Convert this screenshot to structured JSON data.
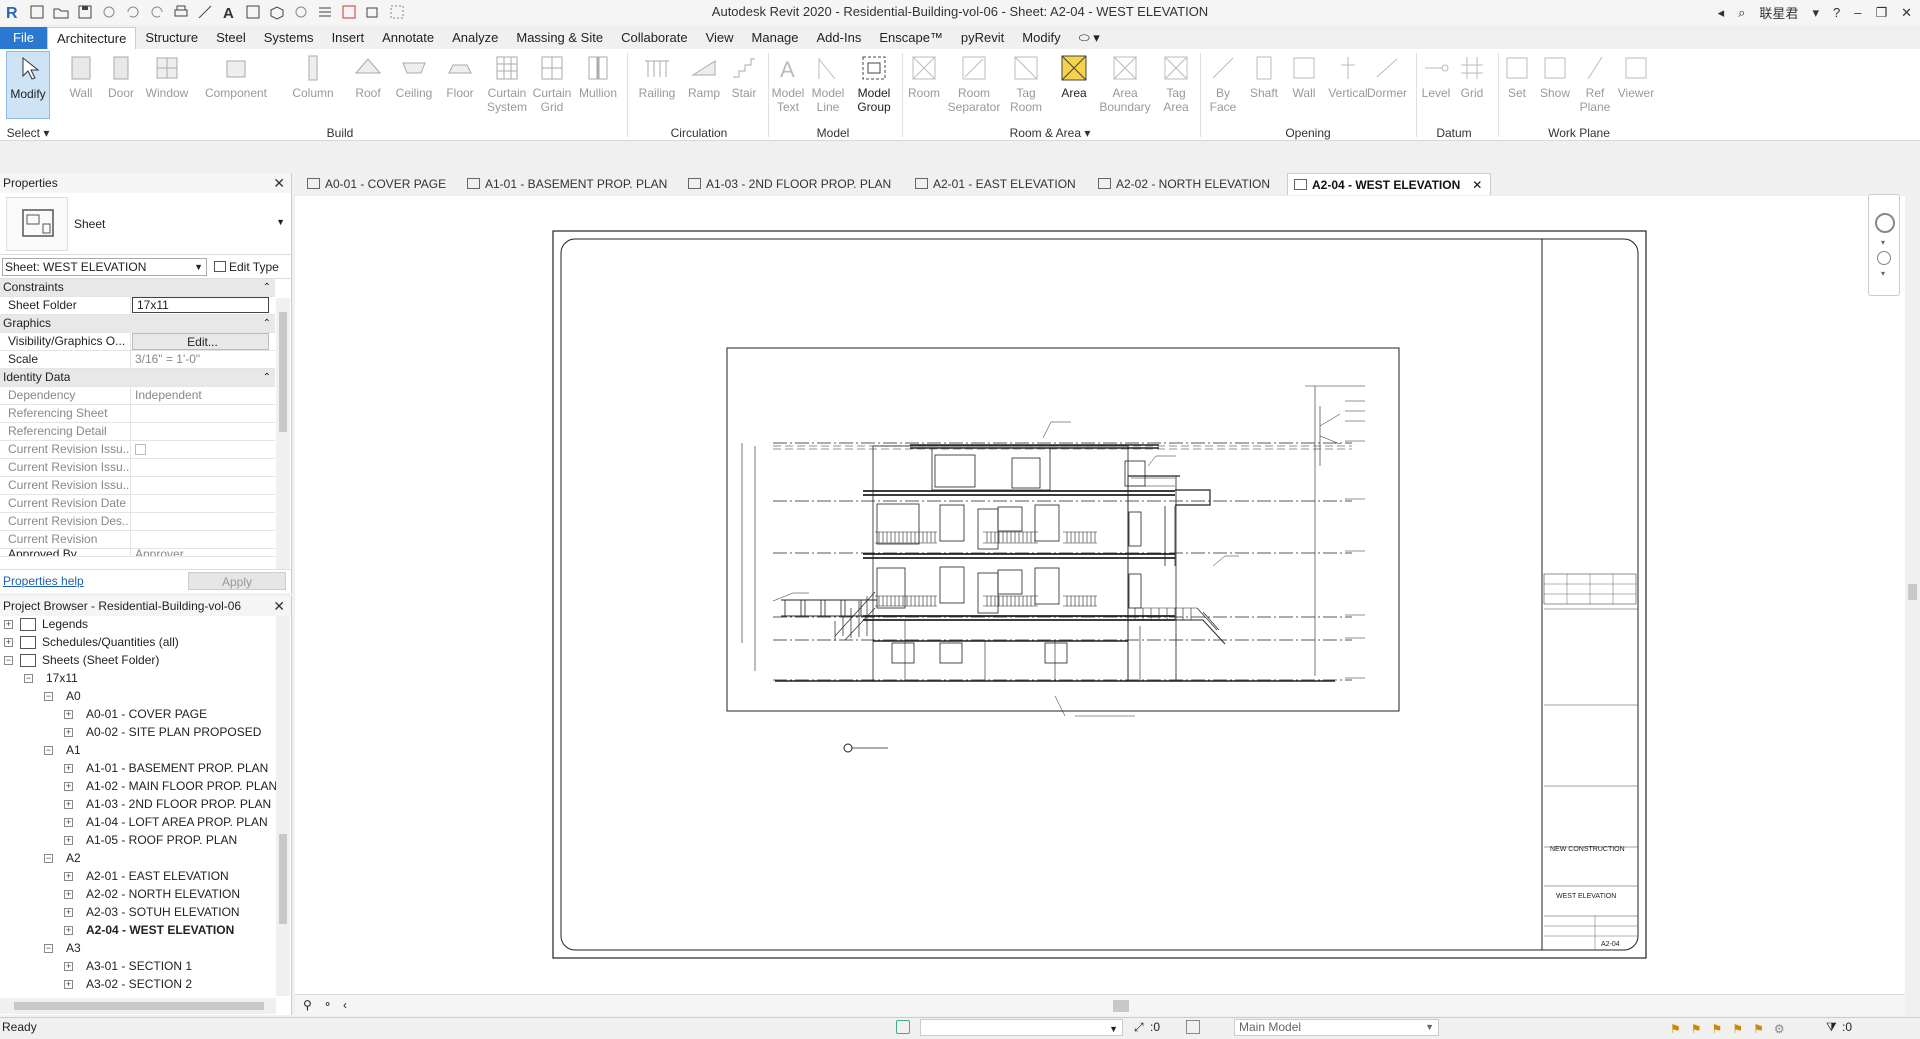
{
  "window": {
    "title": "Autodesk Revit 2020 - Residential-Building-vol-06 - Sheet: A2-04 - WEST ELEVATION",
    "user": "联星君"
  },
  "menu_tabs": [
    {
      "label": "File"
    },
    {
      "label": "Architecture"
    },
    {
      "label": "Structure"
    },
    {
      "label": "Steel"
    },
    {
      "label": "Systems"
    },
    {
      "label": "Insert"
    },
    {
      "label": "Annotate"
    },
    {
      "label": "Analyze"
    },
    {
      "label": "Massing & Site"
    },
    {
      "label": "Collaborate"
    },
    {
      "label": "View"
    },
    {
      "label": "Manage"
    },
    {
      "label": "Add-Ins"
    },
    {
      "label": "Enscape™"
    },
    {
      "label": "pyRevit"
    },
    {
      "label": "Modify"
    }
  ],
  "ribbon": {
    "modify": "Modify",
    "select": "Select",
    "build": {
      "label": "Build",
      "items": [
        "Wall",
        "Door",
        "Window",
        "Component",
        "Column",
        "Roof",
        "Ceiling",
        "Floor",
        "Curtain System",
        "Curtain Grid",
        "Mullion"
      ]
    },
    "circulation": {
      "label": "Circulation",
      "items": [
        "Railing",
        "Ramp",
        "Stair"
      ]
    },
    "model": {
      "label": "Model",
      "items": [
        "Model Text",
        "Model Line",
        "Model Group"
      ]
    },
    "room_area": {
      "label": "Room & Area",
      "items": [
        "Room",
        "Room Separator",
        "Tag Room",
        "Area",
        "Area Boundary",
        "Tag Area"
      ]
    },
    "opening": {
      "label": "Opening",
      "items": [
        "By Face",
        "Shaft",
        "Wall",
        "Vertical",
        "Dormer"
      ]
    },
    "datum": {
      "label": "Datum",
      "items": [
        "Level",
        "Grid"
      ]
    },
    "work_plane": {
      "label": "Work Plane",
      "items": [
        "Set",
        "Show",
        "Ref Plane",
        "Viewer"
      ]
    }
  },
  "properties": {
    "title": "Properties",
    "type_name": "Sheet",
    "selector": "Sheet: WEST ELEVATION",
    "edit_type": "Edit Type",
    "groups": {
      "constraints": "Constraints",
      "graphics": "Graphics",
      "identity": "Identity Data"
    },
    "rows": {
      "sheet_folder_k": "Sheet Folder",
      "sheet_folder_v": "17x11",
      "vis_k": "Visibility/Graphics O...",
      "vis_v": "Edit...",
      "scale_k": "Scale",
      "scale_v": "3/16\" = 1'-0\"",
      "dep_k": "Dependency",
      "dep_v": "Independent",
      "ref_sheet_k": "Referencing Sheet",
      "ref_detail_k": "Referencing Detail",
      "cri1_k": "Current Revision Issu...",
      "cri2_k": "Current Revision Issu...",
      "cri3_k": "Current Revision Issu...",
      "crd_k": "Current Revision Date",
      "crdes_k": "Current Revision Des...",
      "cr_k": "Current Revision",
      "appr_k": "Approved By",
      "appr_v": "Approver"
    },
    "help": "Properties help",
    "apply": "Apply"
  },
  "browser": {
    "title": "Project Browser - Residential-Building-vol-06",
    "legends": "Legends",
    "schedules": "Schedules/Quantities (all)",
    "sheets": "Sheets (Sheet Folder)",
    "folder": "17x11",
    "g_a0": "A0",
    "a0_01": "A0-01 - COVER PAGE",
    "a0_02": "A0-02 - SITE PLAN PROPOSED",
    "g_a1": "A1",
    "a1_01": "A1-01 - BASEMENT PROP. PLAN",
    "a1_02": "A1-02 - MAIN FLOOR PROP. PLAN",
    "a1_03": "A1-03 - 2ND FLOOR PROP. PLAN",
    "a1_04": "A1-04 - LOFT AREA PROP. PLAN",
    "a1_05": "A1-05 - ROOF PROP. PLAN",
    "g_a2": "A2",
    "a2_01": "A2-01 - EAST ELEVATION",
    "a2_02": "A2-02 - NORTH ELEVATION",
    "a2_03": "A2-03 - SOTUH ELEVATION",
    "a2_04": "A2-04 - WEST ELEVATION",
    "g_a3": "A3",
    "a3_01": "A3-01 - SECTION 1",
    "a3_02": "A3-02 - SECTION 2"
  },
  "view_tabs": [
    "A0-01 - COVER PAGE",
    "A1-01 - BASEMENT PROP. PLAN",
    "A1-03 - 2ND FLOOR PROP. PLAN",
    "A2-01 - EAST ELEVATION",
    "A2-02 - NORTH ELEVATION",
    "A2-04 - WEST ELEVATION"
  ],
  "title_block": {
    "project_name": "NEW CONSTRUCTION",
    "sheet_name": "WEST ELEVATION",
    "sheet_number": "A2-04"
  },
  "status": {
    "ready": "Ready",
    "workset_count": ":0",
    "model": "Main Model",
    "filter_count": ":0"
  }
}
